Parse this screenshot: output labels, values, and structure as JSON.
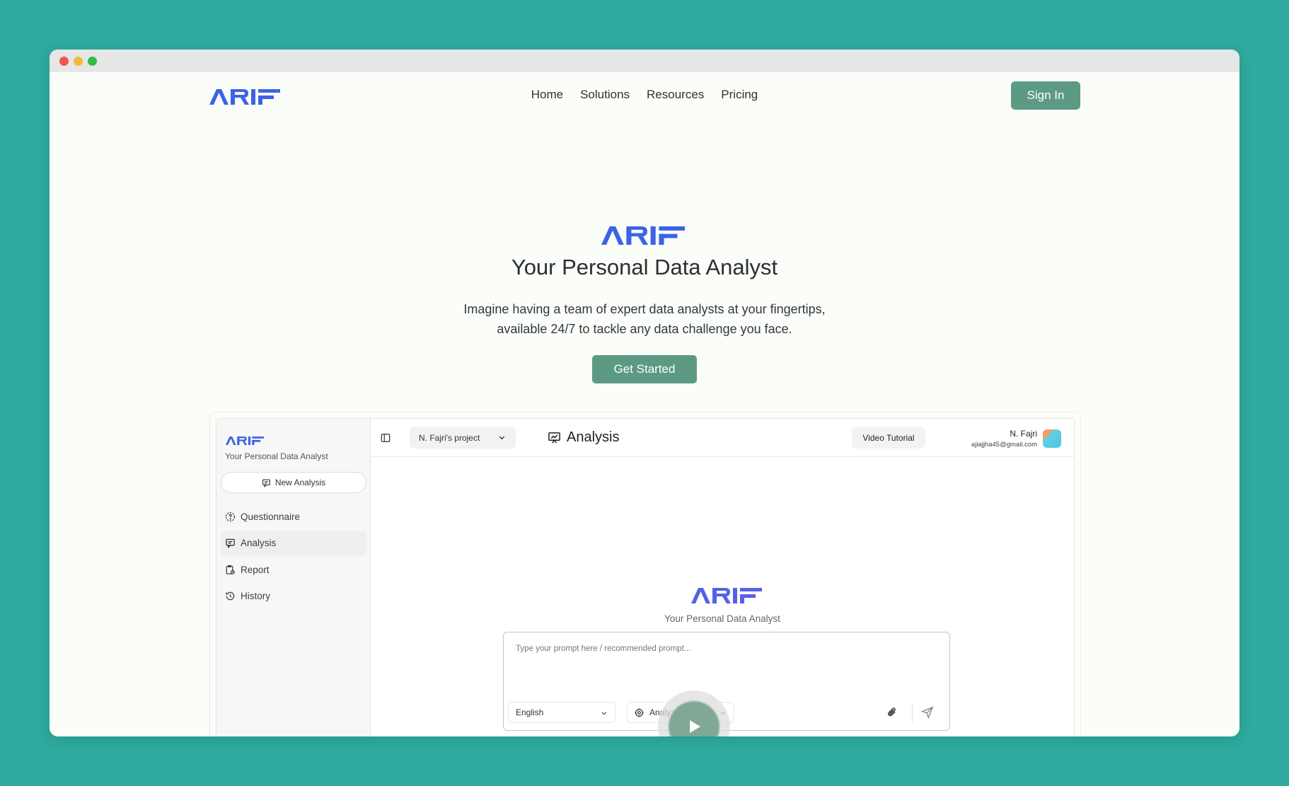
{
  "brand": {
    "logo_text": "ARIF",
    "logo_color": "#3b63e6"
  },
  "nav": {
    "links": [
      "Home",
      "Solutions",
      "Resources",
      "Pricing"
    ],
    "signin_label": "Sign In"
  },
  "hero": {
    "title": "Your Personal Data Analyst",
    "subtitle_line1": "Imagine having a team of expert data analysts at your fingertips,",
    "subtitle_line2": "available 24/7 to tackle any data challenge you face.",
    "cta_label": "Get Started"
  },
  "app": {
    "sidebar": {
      "tagline": "Your Personal Data Analyst",
      "new_analysis_label": "New Analysis",
      "items": [
        {
          "label": "Questionnaire",
          "icon": "questionnaire-icon",
          "active": false
        },
        {
          "label": "Analysis",
          "icon": "chat-icon",
          "active": true
        },
        {
          "label": "Report",
          "icon": "report-icon",
          "active": false
        },
        {
          "label": "History",
          "icon": "history-icon",
          "active": false
        }
      ]
    },
    "topbar": {
      "project": "N. Fajri's project",
      "heading": "Analysis",
      "video_tutorial_label": "Video Tutorial",
      "user_name": "N. Fajri",
      "user_email": "ajiajjha45@gmail.com"
    },
    "main": {
      "tagline": "Your Personal Data Analyst",
      "prompt_placeholder": "Type your prompt here / recommended prompt...",
      "language": "English",
      "mode": "Analyze"
    }
  },
  "colors": {
    "accent": "#5d9a84",
    "background": "#2eaa9e",
    "prompt_border": "#d9b8e6"
  }
}
